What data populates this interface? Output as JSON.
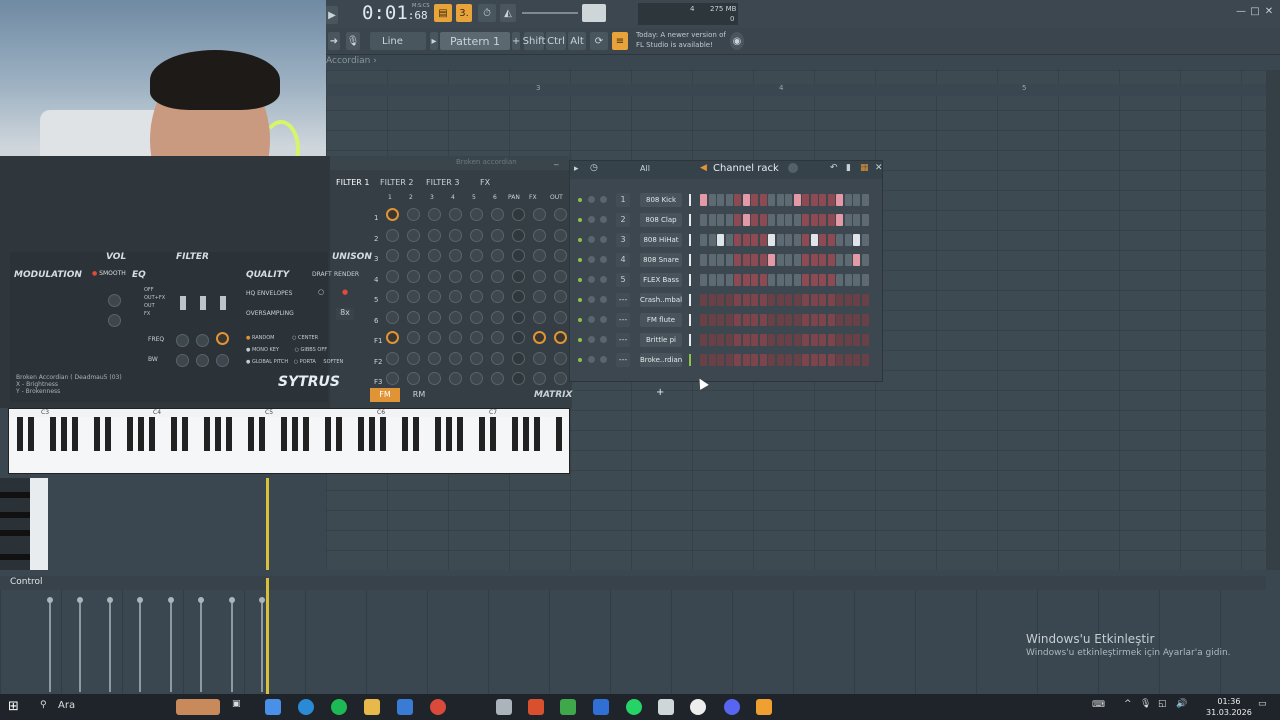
{
  "transport": {
    "time_main": "0:01",
    "time_frac": ":68",
    "time_label": "M:S:CS",
    "cpu_value": "4",
    "mem_value": "275 MB",
    "mem_sub": "0"
  },
  "toolbar": {
    "snap_mode": "Line",
    "pattern_label": "Pattern 1",
    "shift_label": "Shift",
    "ctrl_label": "Ctrl",
    "alt_label": "Alt",
    "news_line1": "Today: A newer version of",
    "news_line2": "FL Studio is available!"
  },
  "playlist": {
    "breadcrumb": "Accordian",
    "ruler_marks": [
      "3",
      "4",
      "5"
    ]
  },
  "synth": {
    "tabs": [
      "FILTER 1",
      "FILTER 2",
      "FILTER 3",
      "FX"
    ],
    "window_title": "Broken accordian",
    "col_headers": [
      "1",
      "2",
      "3",
      "4",
      "5",
      "6",
      "PAN",
      "FX",
      "OUT"
    ],
    "row_labels": [
      "1",
      "2",
      "3",
      "4",
      "5",
      "6",
      "F1",
      "F2",
      "F3"
    ],
    "sections": {
      "vol": "VOL",
      "filter": "FILTER",
      "unison": "UNISON",
      "modulation": "MODULATION",
      "eq": "EQ",
      "quality": "QUALITY"
    },
    "smooth_label": "SMOOTH",
    "modes": [
      "OFF",
      "OUT+FX",
      "OUT",
      "FX"
    ],
    "quality_tabs": [
      "DRAFT",
      "RENDER"
    ],
    "hq_envelopes": "HQ ENVELOPES",
    "oversampling": "OVERSAMPLING",
    "oversampling_value": "8x",
    "freq_label": "FREQ",
    "bw_label": "BW",
    "options": [
      "RANDOM",
      "CENTER",
      "MONO KEY",
      "GIBBS OFF",
      "GLOBAL PITCH",
      "PORTA",
      "SOFTEN"
    ],
    "preset_name": "Broken Accordian",
    "preset_author": "( Deadmau5 (03)",
    "x_param": "X - Brightness",
    "y_param": "Y - Brokenness",
    "logo": "SYTRUS",
    "bottom_tabs": [
      "FM",
      "RM"
    ],
    "matrix_label": "MATRIX",
    "octaves": [
      "C3",
      "C4",
      "C5",
      "C6",
      "C7"
    ]
  },
  "channel_rack": {
    "filter": "All",
    "title": "Channel rack",
    "channels": [
      {
        "num": "1",
        "name": "808 Kick",
        "active": [
          0,
          5,
          11,
          16
        ]
      },
      {
        "num": "2",
        "name": "808 Clap",
        "active": [
          5,
          16
        ]
      },
      {
        "num": "3",
        "name": "808 HiHat",
        "active": [
          2,
          8,
          13,
          18
        ]
      },
      {
        "num": "4",
        "name": "808 Snare",
        "active": [
          8,
          18
        ]
      },
      {
        "num": "5",
        "name": "FLEX Bass",
        "active": []
      },
      {
        "num": "---",
        "name": "Crash..mbal",
        "active": []
      },
      {
        "num": "---",
        "name": "FM flute",
        "active": []
      },
      {
        "num": "---",
        "name": "Brittle pi",
        "active": []
      },
      {
        "num": "---",
        "name": "Broke..rdian",
        "active": []
      }
    ],
    "add_label": "+"
  },
  "control": {
    "label": "Control"
  },
  "windows_notice": {
    "title": "Windows'u Etkinleştir",
    "subtitle": "Windows'u etkinleştirmek için Ayarlar'a gidin."
  },
  "taskbar": {
    "search": "Ara",
    "time": "01:36",
    "date": "31.03.2026"
  }
}
